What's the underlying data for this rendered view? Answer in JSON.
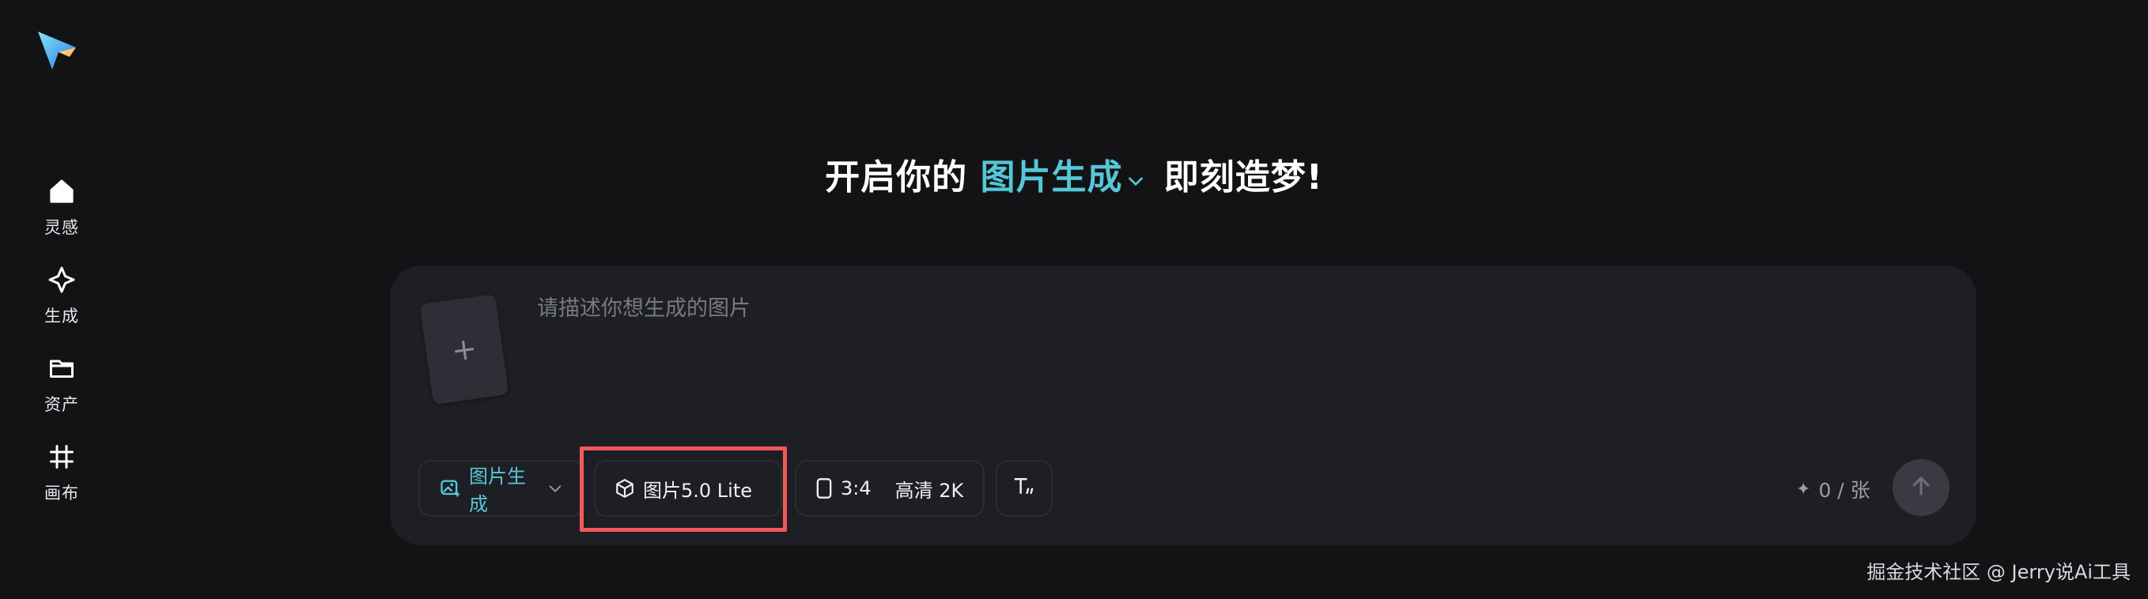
{
  "sidebar": {
    "logo": "paper-plane-logo",
    "items": [
      {
        "label": "灵感",
        "icon": "home-icon"
      },
      {
        "label": "生成",
        "icon": "sparkle-icon"
      },
      {
        "label": "资产",
        "icon": "folder-icon"
      },
      {
        "label": "画布",
        "icon": "frame-icon"
      }
    ]
  },
  "heading": {
    "prefix": "开启你的",
    "accent": "图片生成",
    "suffix": "即刻造梦!"
  },
  "composer": {
    "placeholder": "请描述你想生成的图片",
    "upload_symbol": "+",
    "mode_label": "图片生成",
    "model_label": "图片5.0 Lite",
    "ratio_label": "3:4",
    "quality_label": "高清 2K",
    "credits": "0 / 张"
  },
  "watermark": "掘金技术社区 @ Jerry说Ai工具",
  "colors": {
    "accent": "#55c7d8",
    "highlight": "#f05a5a",
    "background": "#131316",
    "panel": "#1e1f24"
  }
}
